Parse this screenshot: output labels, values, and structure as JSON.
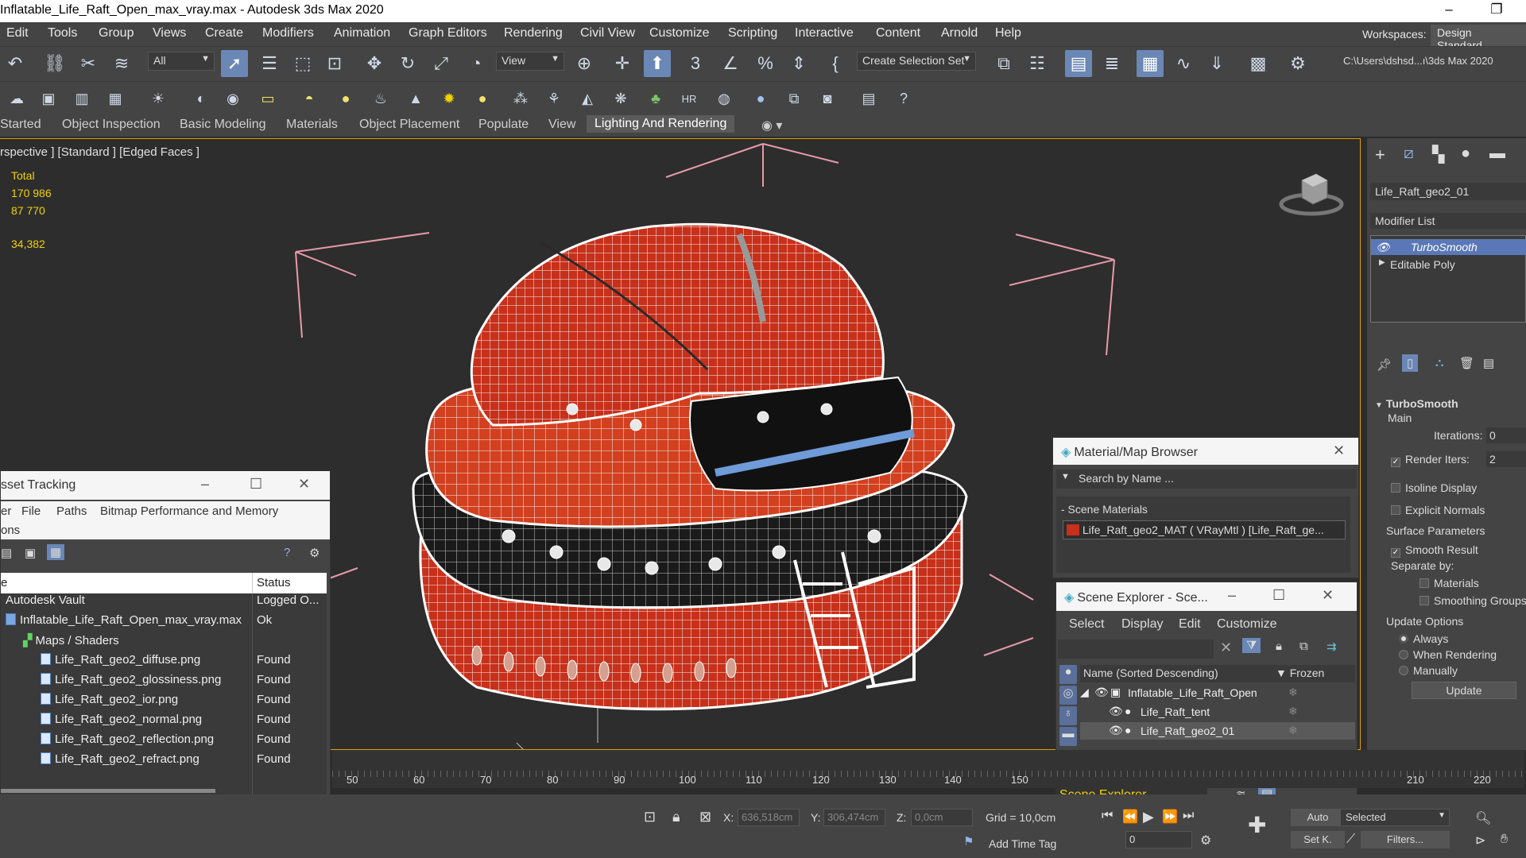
{
  "window": {
    "title": "Inflatable_Life_Raft_Open_max_vray.max - Autodesk 3ds Max 2020",
    "minimize": "–",
    "maximize": "❐"
  },
  "menu": [
    "Edit",
    "Tools",
    "Group",
    "Views",
    "Create",
    "Modifiers",
    "Animation",
    "Graph Editors",
    "Rendering",
    "Civil View",
    "Customize",
    "Scripting",
    "Interactive",
    "Content",
    "Arnold",
    "Help"
  ],
  "workspaces": {
    "label": "Workspaces:",
    "value": "Design Standard"
  },
  "toolbar": {
    "filter": "All",
    "ref_coord": "View",
    "selection_set": "Create Selection Set",
    "project_path": "C:\\Users\\dshsd...ı\\3ds Max 2020"
  },
  "ribbon_tabs": [
    "Started",
    "Object Inspection",
    "Basic Modeling",
    "Materials",
    "Object Placement",
    "Populate",
    "View",
    "Lighting And Rendering"
  ],
  "ribbon_active": "Lighting And Rendering",
  "viewport": {
    "label": "rspective ] [Standard ] [Edged Faces ]",
    "stats": {
      "total_label": "Total",
      "polys": "170 986",
      "verts": "87 770",
      "fps": "34,382"
    }
  },
  "asset_tracking": {
    "title": "sset Tracking",
    "menu": [
      "er",
      "File",
      "Paths",
      "Bitmap Performance and Memory"
    ],
    "submenu": "ons",
    "columns": {
      "name": "e",
      "status": "Status"
    },
    "rows": [
      {
        "name": "Autodesk Vault",
        "status": "Logged O..."
      },
      {
        "name": "Inflatable_Life_Raft_Open_max_vray.max",
        "status": "Ok"
      },
      {
        "name": "Maps / Shaders",
        "status": ""
      },
      {
        "name": "Life_Raft_geo2_diffuse.png",
        "status": "Found"
      },
      {
        "name": "Life_Raft_geo2_glossiness.png",
        "status": "Found"
      },
      {
        "name": "Life_Raft_geo2_ior.png",
        "status": "Found"
      },
      {
        "name": "Life_Raft_geo2_normal.png",
        "status": "Found"
      },
      {
        "name": "Life_Raft_geo2_reflection.png",
        "status": "Found"
      },
      {
        "name": "Life_Raft_geo2_refract.png",
        "status": "Found"
      }
    ]
  },
  "material_browser": {
    "title": "Material/Map Browser",
    "search_placeholder": "Search by Name ...",
    "section": "- Scene Materials",
    "material": "Life_Raft_geo2_MAT  ( VRayMtl )  [Life_Raft_ge..."
  },
  "scene_explorer": {
    "title": "Scene Explorer - Sce...",
    "menu": [
      "Select",
      "Display",
      "Edit",
      "Customize"
    ],
    "col_name": "Name (Sorted Descending)",
    "col_frozen": "▼ Frozen",
    "items": [
      "Inflatable_Life_Raft_Open",
      "Life_Raft_tent",
      "Life_Raft_geo2_01"
    ],
    "footer": "Scene Explorer"
  },
  "command_panel": {
    "object_name": "Life_Raft_geo2_01",
    "modifier_list": "Modifier List",
    "stack": [
      "TurboSmooth",
      "Editable Poly"
    ],
    "rollout": "TurboSmooth",
    "main": "Main",
    "iterations_label": "Iterations:",
    "iterations_value": "0",
    "render_iters_label": "Render Iters:",
    "render_iters_value": "2",
    "isoline": "Isoline Display",
    "explicit": "Explicit Normals",
    "surface_params": "Surface Parameters",
    "smooth_result": "Smooth Result",
    "separate_by": "Separate by:",
    "materials": "Materials",
    "smoothing_groups": "Smoothing Groups",
    "update_options": "Update Options",
    "always": "Always",
    "when_rendering": "When Rendering",
    "manually": "Manually",
    "update_button": "Update"
  },
  "timeline_ticks": [
    "50",
    "60",
    "70",
    "80",
    "90",
    "100",
    "110",
    "120",
    "130",
    "140",
    "150",
    "210",
    "220"
  ],
  "statusbar": {
    "x_label": "X:",
    "x": "636,518cm",
    "y_label": "Y:",
    "y": "306,474cm",
    "z_label": "Z:",
    "z": "0,0cm",
    "grid": "Grid = 10,0cm",
    "add_time_tag": "Add Time Tag",
    "frame": "0",
    "auto": "Auto",
    "setk": "Set K.",
    "selected": "Selected",
    "filters": "Filters..."
  }
}
